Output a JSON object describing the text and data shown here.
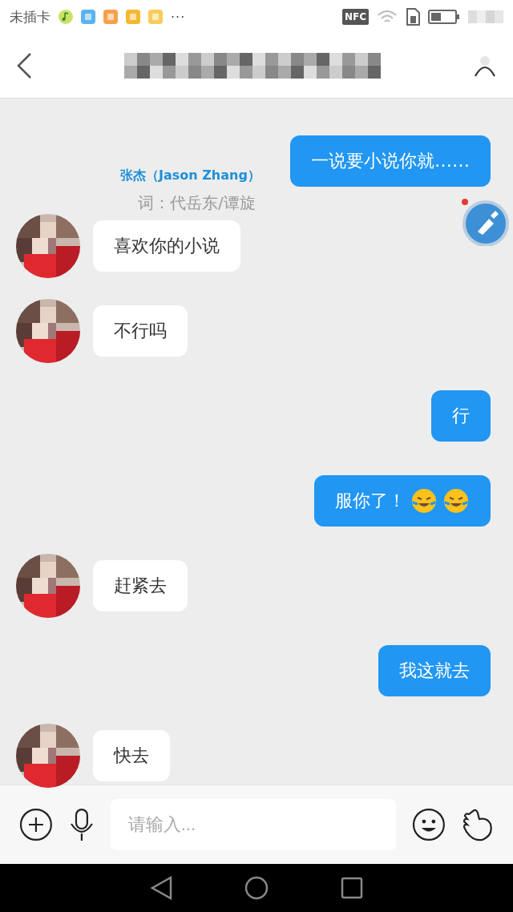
{
  "status_bar": {
    "carrier": "未插卡",
    "more": "···",
    "nfc": "NFC"
  },
  "lyrics": {
    "artist": "张杰（Jason Zhang）",
    "lyricist": "词：代岳东/谭旋"
  },
  "messages": [
    {
      "kind": "outgoing",
      "parts": [
        {
          "kind": "text",
          "text": "一说要小说你就……"
        }
      ]
    },
    {
      "kind": "incoming",
      "parts": [
        {
          "kind": "text",
          "text": "喜欢你的小说"
        }
      ]
    },
    {
      "kind": "incoming",
      "parts": [
        {
          "kind": "text",
          "text": "不行吗"
        }
      ]
    },
    {
      "kind": "outgoing",
      "parts": [
        {
          "kind": "text",
          "text": "行"
        }
      ]
    },
    {
      "kind": "outgoing",
      "parts": [
        {
          "kind": "text",
          "text": "服你了！"
        },
        {
          "kind": "emoji"
        },
        {
          "kind": "emoji"
        }
      ]
    },
    {
      "kind": "incoming",
      "parts": [
        {
          "kind": "text",
          "text": "赶紧去"
        }
      ]
    },
    {
      "kind": "outgoing",
      "parts": [
        {
          "kind": "text",
          "text": "我这就去"
        }
      ]
    },
    {
      "kind": "incoming",
      "parts": [
        {
          "kind": "text",
          "text": "快去"
        }
      ]
    }
  ],
  "input": {
    "placeholder": "请输入..."
  }
}
